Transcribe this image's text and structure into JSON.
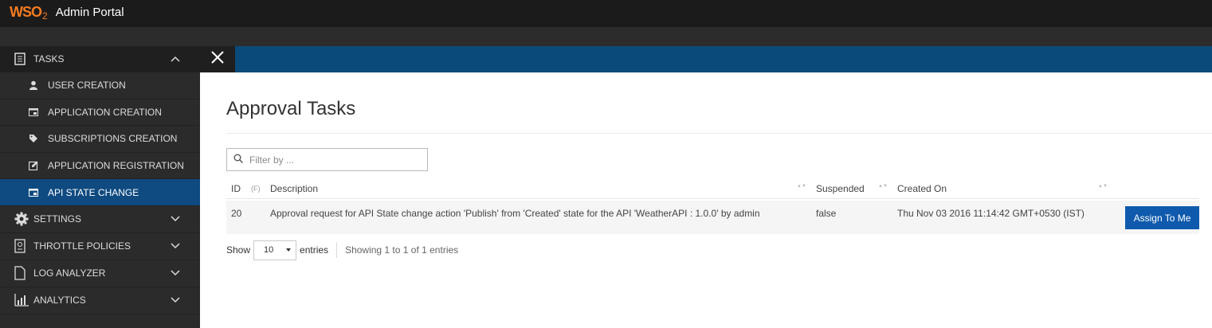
{
  "header": {
    "logo_main": "WSO",
    "logo_sub": "2",
    "title": "Admin Portal"
  },
  "sidebar": {
    "tasks_label": "TASKS",
    "items": [
      {
        "label": "USER CREATION",
        "icon": "user-icon"
      },
      {
        "label": "APPLICATION CREATION",
        "icon": "window-icon"
      },
      {
        "label": "SUBSCRIPTIONS CREATION",
        "icon": "tag-icon"
      },
      {
        "label": "APPLICATION REGISTRATION",
        "icon": "edit-icon"
      },
      {
        "label": "API STATE CHANGE",
        "icon": "window-icon"
      }
    ],
    "sections": [
      {
        "label": "SETTINGS",
        "icon": "gear-icon"
      },
      {
        "label": "THROTTLE POLICIES",
        "icon": "policy-icon"
      },
      {
        "label": "LOG ANALYZER",
        "icon": "file-icon"
      },
      {
        "label": "ANALYTICS",
        "icon": "chart-icon"
      }
    ]
  },
  "main": {
    "title": "Approval Tasks",
    "filter_placeholder": "Filter by ...",
    "table": {
      "headers": {
        "id": "ID",
        "flag": "(F)",
        "description": "Description",
        "suspended": "Suspended",
        "created_on": "Created On"
      },
      "rows": [
        {
          "id": "20",
          "description": "Approval request for API State change action 'Publish' from 'Created' state for the API 'WeatherAPI : 1.0.0' by admin",
          "suspended": "false",
          "created_on": "Thu Nov 03 2016 11:14:42 GMT+0530 (IST)",
          "action": "Assign To Me"
        }
      ]
    },
    "footer": {
      "show": "Show",
      "page_size": "10",
      "entries": "entries",
      "info": "Showing 1 to 1 of 1 entries"
    }
  },
  "colors": {
    "accent": "#0f4a80",
    "button": "#0f5aad",
    "logo": "#f47b20"
  }
}
